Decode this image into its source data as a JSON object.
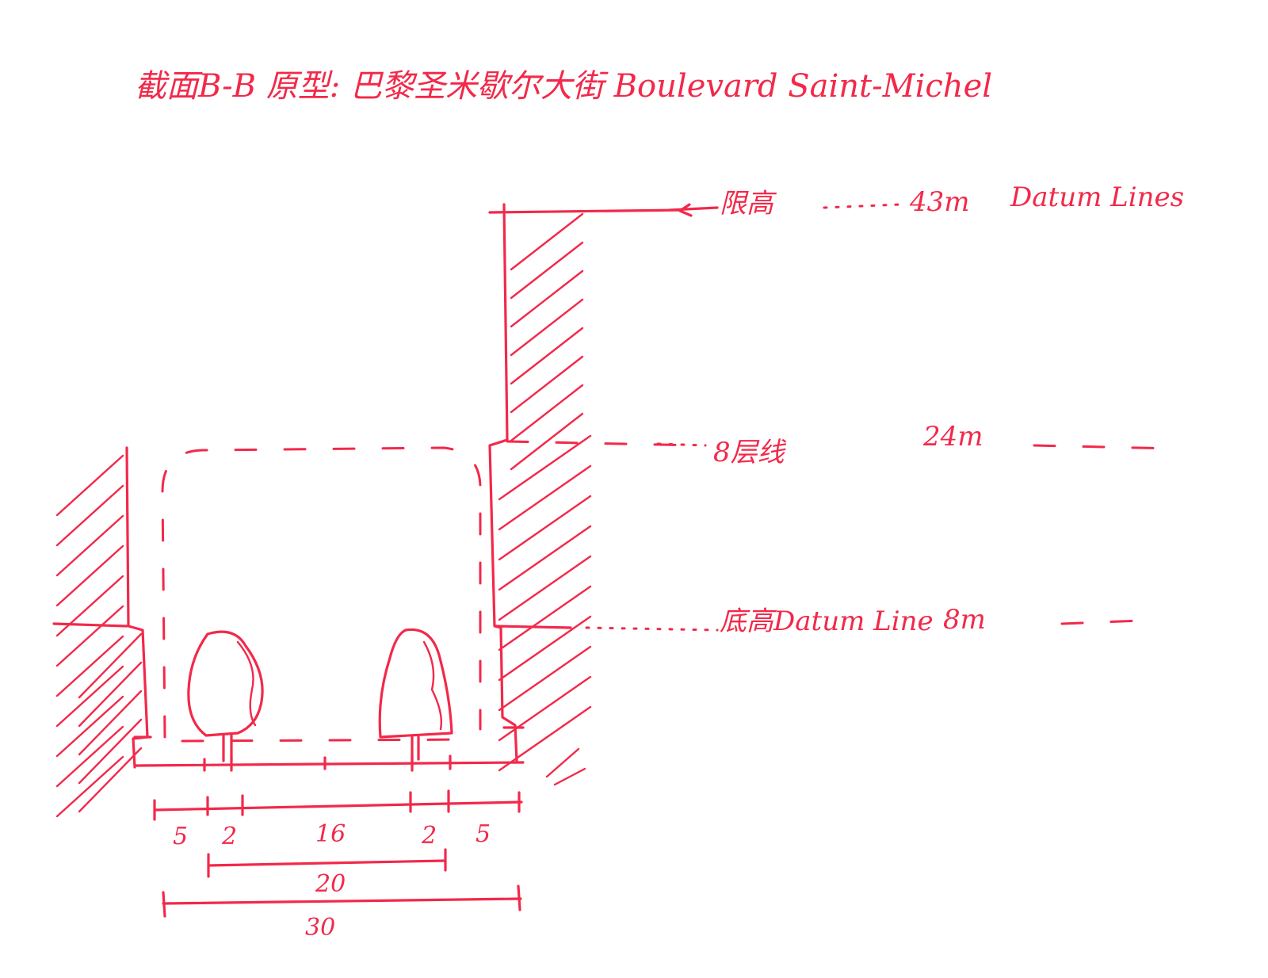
{
  "title": "截面B-B 原型: 巴黎圣米歇尔大街 Boulevard Saint-Michel",
  "datum_lines": {
    "height_limit": {
      "label": "限高",
      "value": "43m",
      "caption": "Datum Lines"
    },
    "floor_8": {
      "label": "8层线",
      "value": "24m"
    },
    "base": {
      "label": "底高Datum Line",
      "value": "8m"
    }
  },
  "dimensions": {
    "row1": [
      "5",
      "2",
      "16",
      "2",
      "5"
    ],
    "middle_total": "20",
    "overall_total": "30"
  },
  "colors": {
    "ink": "#f2294a",
    "paper": "#ffffff"
  }
}
